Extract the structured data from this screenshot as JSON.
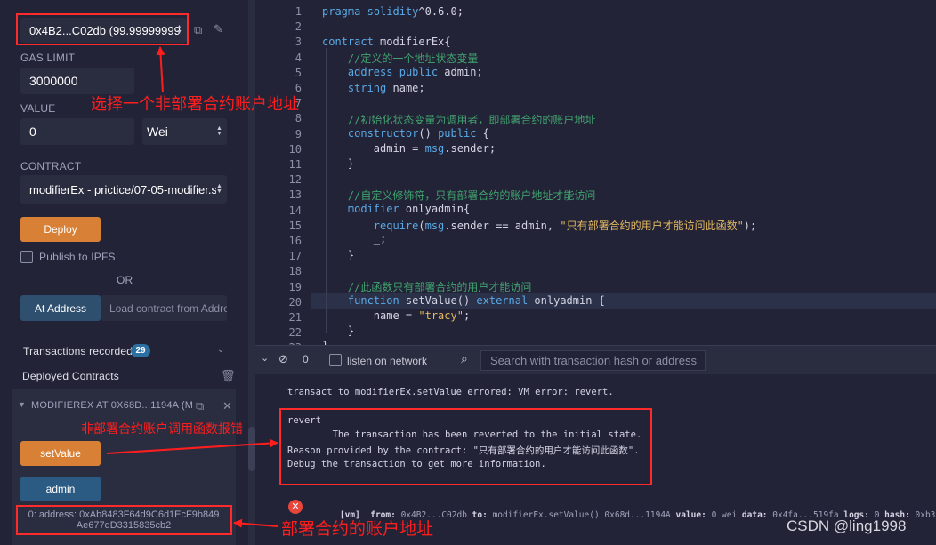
{
  "left_panel": {
    "account": "0x4B2...C02db (99.99999999",
    "gas_limit_label": "GAS LIMIT",
    "gas_limit_value": "3000000",
    "value_label": "VALUE",
    "value_amount": "0",
    "value_unit": "Wei",
    "contract_label": "CONTRACT",
    "contract_select": "modifierEx - prictice/07-05-modifier.s",
    "deploy_label": "Deploy",
    "publish_label": "Publish to IPFS",
    "or_label": "OR",
    "at_address_label": "At Address",
    "load_placeholder": "Load contract from Addre",
    "transactions_label": "Transactions recorded",
    "transactions_count": "29",
    "deployed_label": "Deployed Contracts",
    "instance_label": "MODIFIEREX AT 0X68D...1194A (M",
    "setvalue_label": "setValue",
    "admin_label": "admin",
    "admin_result_line1": "0: address: 0xAb8483F64d9C6d1EcF9b849",
    "admin_result_line2": "Ae677dD3315835cb2"
  },
  "editor": {
    "line_numbers": [
      "1",
      "2",
      "3",
      "4",
      "5",
      "6",
      "7",
      "8",
      "9",
      "10",
      "11",
      "12",
      "13",
      "14",
      "15",
      "16",
      "17",
      "18",
      "19",
      "20",
      "21",
      "22",
      "23"
    ]
  },
  "terminal": {
    "count": "0",
    "listen_label": "listen on network",
    "search_placeholder": "Search with transaction hash or address",
    "line1": "transact to modifierEx.setValue errored: VM error: revert.",
    "revert_title": "revert",
    "revert_line1": "        The transaction has been reverted to the initial state.",
    "revert_line2": "Reason provided by the contract: \"只有部署合约的用户才能访问此函数\".",
    "revert_line3": "Debug the transaction to get more information.",
    "tx_vm": "[vm]",
    "tx_from_k": "from:",
    "tx_from_v": "0x4B2...C02db",
    "tx_to_k": "to:",
    "tx_to_v": "modifierEx.setValue() 0x68d...1194A",
    "tx_value_k": "value:",
    "tx_value_v": "0 wei",
    "tx_data_k": "data:",
    "tx_data_v": "0x4fa...519fa",
    "tx_logs_k": "logs:",
    "tx_logs_v": "0",
    "tx_hash_k": "hash:",
    "tx_hash_v": "0xb35...8cae1"
  },
  "annotations": {
    "select_account": "选择一个非部署合约账户地址",
    "call_error": "非部署合约账户调用函数报错",
    "deploy_address": "部署合约的账户地址"
  },
  "watermark": "CSDN @ling1998",
  "colors": {
    "background": "#222336",
    "input": "#2a2c3f",
    "deploy_orange": "#d88035",
    "call_blue": "#2b5a83",
    "annotation_red": "#ff1e1e"
  }
}
